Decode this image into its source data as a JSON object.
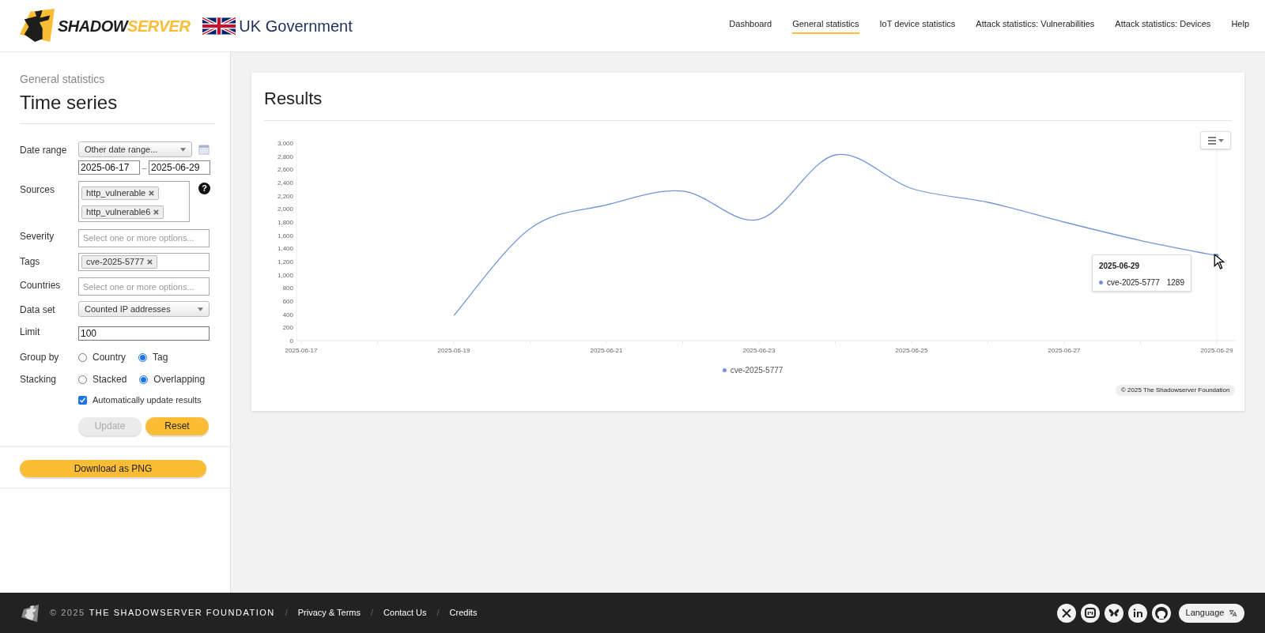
{
  "header": {
    "logo": {
      "part_1": "SHADOW",
      "part_2": "SERVER"
    },
    "partner": "UK Government",
    "nav": [
      {
        "label": "Dashboard",
        "selected": false
      },
      {
        "label": "General statistics",
        "selected": true
      },
      {
        "label": "IoT device statistics",
        "selected": false
      },
      {
        "label": "Attack statistics: Vulnerabilities",
        "selected": false
      },
      {
        "label": "Attack statistics: Devices",
        "selected": false
      },
      {
        "label": "Help",
        "selected": false
      }
    ]
  },
  "sidebar": {
    "breadcrumb": "General statistics",
    "title": "Time series",
    "date_range": {
      "label": "Date range",
      "select": "Other date range...",
      "from": "2025-06-17",
      "separator": "–",
      "to": "2025-06-29"
    },
    "sources": {
      "label": "Sources",
      "tags": [
        "http_vulnerable",
        "http_vulnerable6"
      ],
      "help": "?"
    },
    "severity": {
      "label": "Severity",
      "placeholder": "Select one or more options..."
    },
    "tags": {
      "label": "Tags",
      "tags": [
        "cve-2025-5777"
      ]
    },
    "countries": {
      "label": "Countries",
      "placeholder": "Select one or more options..."
    },
    "data_set": {
      "label": "Data set",
      "value": "Counted IP addresses"
    },
    "limit": {
      "label": "Limit",
      "value": "100"
    },
    "group_by": {
      "label": "Group by",
      "options": [
        {
          "label": "Country",
          "selected": false
        },
        {
          "label": "Tag",
          "selected": true
        }
      ]
    },
    "stacking": {
      "label": "Stacking",
      "options": [
        {
          "label": "Stacked",
          "selected": false
        },
        {
          "label": "Overlapping",
          "selected": true
        }
      ]
    },
    "auto_update": {
      "label": "Automatically update results",
      "checked": true
    },
    "buttons": [
      {
        "label": "Update",
        "disabled": true
      },
      {
        "label": "Reset",
        "disabled": false
      }
    ],
    "download": "Download as PNG"
  },
  "results": {
    "title": "Results",
    "chart_data": {
      "type": "line",
      "categories": [
        "2025-06-17",
        null,
        "2025-06-19",
        null,
        "2025-06-21",
        null,
        "2025-06-23",
        null,
        "2025-06-25",
        null,
        "2025-06-27",
        null,
        "2025-06-29"
      ],
      "series": [
        {
          "name": "cve-2025-5777",
          "color": "#6f95dc",
          "values": [
            null,
            null,
            380,
            1700,
            2060,
            2270,
            1840,
            2820,
            2310,
            2100,
            1800,
            1520,
            1289
          ]
        }
      ],
      "ylim": [
        0,
        3000
      ],
      "yticks": [
        {
          "value": 0,
          "label": "0"
        },
        {
          "value": 200,
          "label": "200"
        },
        {
          "value": 400,
          "label": "400"
        },
        {
          "value": 600,
          "label": "600"
        },
        {
          "value": 800,
          "label": "800"
        },
        {
          "value": 1000,
          "label": "1,000"
        },
        {
          "value": 1200,
          "label": "1,200"
        },
        {
          "value": 1400,
          "label": "1,400"
        },
        {
          "value": 1600,
          "label": "1,600"
        },
        {
          "value": 1800,
          "label": "1,800"
        },
        {
          "value": 2000,
          "label": "2,000"
        },
        {
          "value": 2200,
          "label": "2,200"
        },
        {
          "value": 2400,
          "label": "2,400"
        },
        {
          "value": 2600,
          "label": "2,600"
        },
        {
          "value": 2800,
          "label": "2,800"
        },
        {
          "value": 3000,
          "label": "3,000"
        }
      ]
    },
    "tooltip": {
      "date": "2025-06-29",
      "series": "cve-2025-5777",
      "value": "1289"
    },
    "credit": "© 2025 The Shadowserver Foundation"
  },
  "footer": {
    "year": "© 2025",
    "org": "THE SHADOWSERVER FOUNDATION",
    "links": [
      {
        "separator": "/",
        "label": "Privacy & Terms"
      },
      {
        "separator": "/",
        "label": "Contact Us"
      },
      {
        "separator": "/",
        "label": "Credits"
      }
    ],
    "language": "Language"
  }
}
